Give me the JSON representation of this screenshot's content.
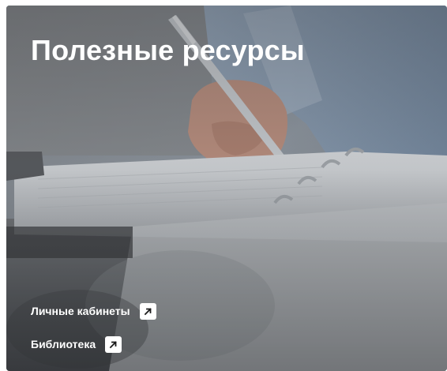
{
  "card": {
    "title": "Полезные ресурсы",
    "links": [
      {
        "label": "Личные кабинеты",
        "icon": "external-link-arrow-icon"
      },
      {
        "label": "Библиотека",
        "icon": "external-link-arrow-icon"
      }
    ]
  },
  "colors": {
    "text": "#ffffff",
    "icon_box": "#ffffff",
    "icon_glyph": "#1a1a1a"
  }
}
